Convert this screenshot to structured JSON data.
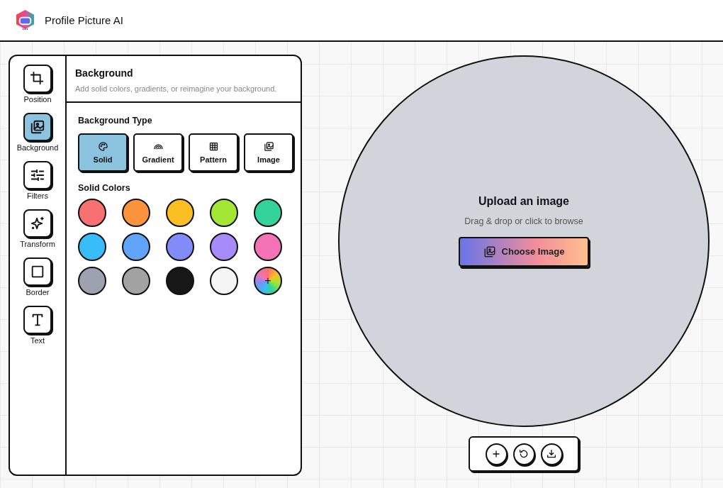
{
  "header": {
    "title": "Profile Picture AI"
  },
  "tools": [
    {
      "label": "Position",
      "selected": false
    },
    {
      "label": "Background",
      "selected": true
    },
    {
      "label": "Filters",
      "selected": false
    },
    {
      "label": "Transform",
      "selected": false
    },
    {
      "label": "Border",
      "selected": false
    },
    {
      "label": "Text",
      "selected": false
    }
  ],
  "panel": {
    "title": "Background",
    "subtitle": "Add solid colors, gradients, or reimagine your background.",
    "type_heading": "Background Type",
    "types": [
      {
        "label": "Solid",
        "selected": true
      },
      {
        "label": "Gradient",
        "selected": false
      },
      {
        "label": "Pattern",
        "selected": false
      },
      {
        "label": "Image",
        "selected": false
      }
    ],
    "colors_heading": "Solid Colors",
    "swatches": [
      {
        "kind": "color",
        "color": "#f87171"
      },
      {
        "kind": "color",
        "color": "#fb923c"
      },
      {
        "kind": "color",
        "color": "#fbbf24"
      },
      {
        "kind": "color",
        "color": "#a3e635"
      },
      {
        "kind": "color",
        "color": "#34d399"
      },
      {
        "kind": "color",
        "color": "#38bdf8"
      },
      {
        "kind": "color",
        "color": "#60a5fa"
      },
      {
        "kind": "color",
        "color": "#818cf8"
      },
      {
        "kind": "color",
        "color": "#a78bfa"
      },
      {
        "kind": "color",
        "color": "#f472b6"
      },
      {
        "kind": "color",
        "color": "#9ca3af"
      },
      {
        "kind": "color",
        "color": "#a3a3a3"
      },
      {
        "kind": "color",
        "color": "#171717"
      },
      {
        "kind": "color",
        "color": "#f5f5f5"
      },
      {
        "kind": "custom",
        "label": "+"
      }
    ]
  },
  "upload": {
    "title": "Upload an image",
    "hint": "Drag & drop or click to browse",
    "button": "Choose Image"
  }
}
